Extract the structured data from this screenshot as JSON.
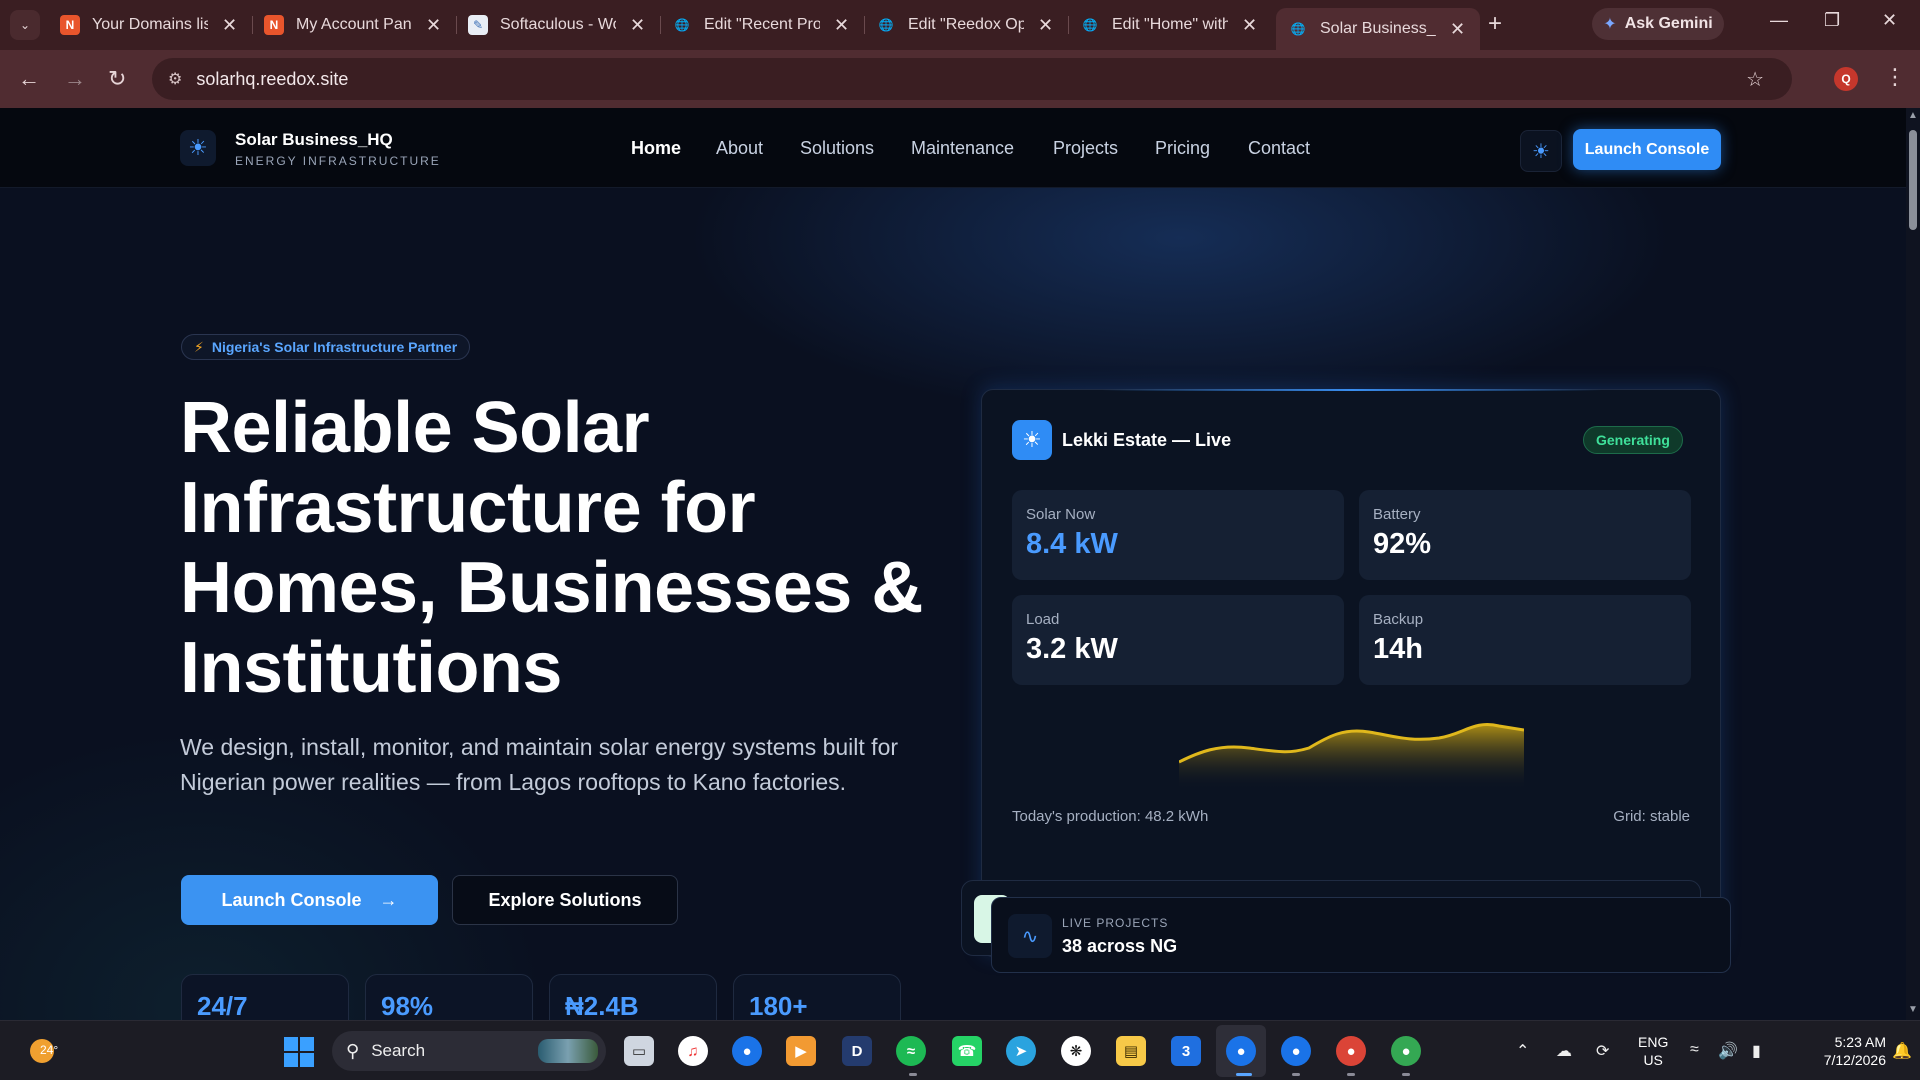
{
  "browser": {
    "tabs": [
      {
        "title": "Your Domains list",
        "icon": "namecheap-icon"
      },
      {
        "title": "My Account Panel",
        "icon": "namecheap-icon"
      },
      {
        "title": "Softaculous - WordPress",
        "icon": "softaculous-icon"
      },
      {
        "title": "Edit \"Recent Projects\"",
        "icon": "globe-icon"
      },
      {
        "title": "Edit \"Reedox Operations\"",
        "icon": "globe-icon"
      },
      {
        "title": "Edit \"Home\" with Elementor",
        "icon": "globe-icon"
      },
      {
        "title": "Solar Business_HQ",
        "icon": "globe-icon",
        "active": true
      }
    ],
    "gemini_label": "Ask Gemini",
    "url": "solarhq.reedox.site",
    "profile_initial": "Q"
  },
  "site": {
    "brand": {
      "name": "Solar Business_HQ",
      "tagline": "ENERGY INFRASTRUCTURE"
    },
    "nav": [
      "Home",
      "About",
      "Solutions",
      "Maintenance",
      "Projects",
      "Pricing",
      "Contact"
    ],
    "launch_label": "Launch Console",
    "hero": {
      "pill": "Nigeria's Solar Infrastructure Partner",
      "title": "Reliable Solar Infrastructure for Homes, Businesses & Institutions",
      "subtitle": "We design, install, monitor, and maintain solar energy systems built for Nigerian power realities — from Lagos rooftops to Kano factories.",
      "primary_cta": "Launch Console",
      "secondary_cta": "Explore Solutions",
      "stats": [
        "24/7",
        "98%",
        "₦2.4B",
        "180+"
      ]
    },
    "live_card": {
      "title": "Lekki Estate — Live",
      "status": "Generating",
      "metrics": [
        {
          "label": "Solar Now",
          "value": "8.4 kW"
        },
        {
          "label": "Battery",
          "value": "92%"
        },
        {
          "label": "Load",
          "value": "3.2 kW"
        },
        {
          "label": "Backup",
          "value": "14h"
        }
      ],
      "production": "Today's production: 48.2 kWh",
      "grid": "Grid: stable"
    },
    "projects_card": {
      "label": "LIVE PROJECTS",
      "value": "38 across NG"
    }
  },
  "taskbar": {
    "weather_temp": "24°",
    "search_label": "Search",
    "lang_top": "ENG",
    "lang_bottom": "US",
    "time": "5:23 AM",
    "date": "7/12/2026"
  },
  "colors": {
    "accent": "#2f8cf5",
    "status_green": "#3fe09a",
    "chart_gold": "#e0b81c"
  }
}
